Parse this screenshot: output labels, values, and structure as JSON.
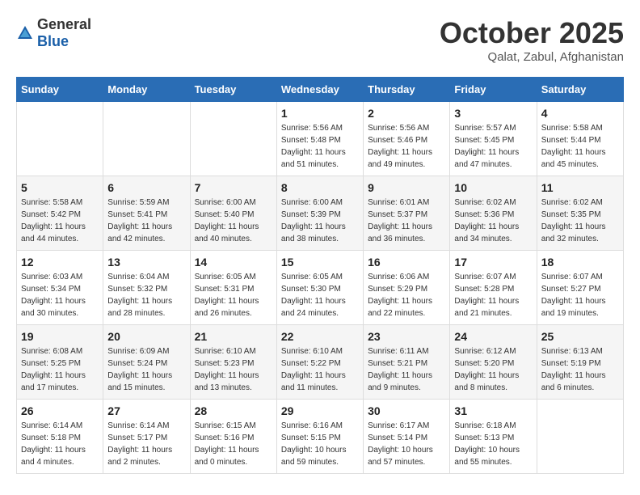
{
  "logo": {
    "general": "General",
    "blue": "Blue"
  },
  "header": {
    "title": "October 2025",
    "subtitle": "Qalat, Zabul, Afghanistan"
  },
  "weekdays": [
    "Sunday",
    "Monday",
    "Tuesday",
    "Wednesday",
    "Thursday",
    "Friday",
    "Saturday"
  ],
  "weeks": [
    [
      {
        "day": "",
        "info": ""
      },
      {
        "day": "",
        "info": ""
      },
      {
        "day": "",
        "info": ""
      },
      {
        "day": "1",
        "info": "Sunrise: 5:56 AM\nSunset: 5:48 PM\nDaylight: 11 hours\nand 51 minutes."
      },
      {
        "day": "2",
        "info": "Sunrise: 5:56 AM\nSunset: 5:46 PM\nDaylight: 11 hours\nand 49 minutes."
      },
      {
        "day": "3",
        "info": "Sunrise: 5:57 AM\nSunset: 5:45 PM\nDaylight: 11 hours\nand 47 minutes."
      },
      {
        "day": "4",
        "info": "Sunrise: 5:58 AM\nSunset: 5:44 PM\nDaylight: 11 hours\nand 45 minutes."
      }
    ],
    [
      {
        "day": "5",
        "info": "Sunrise: 5:58 AM\nSunset: 5:42 PM\nDaylight: 11 hours\nand 44 minutes."
      },
      {
        "day": "6",
        "info": "Sunrise: 5:59 AM\nSunset: 5:41 PM\nDaylight: 11 hours\nand 42 minutes."
      },
      {
        "day": "7",
        "info": "Sunrise: 6:00 AM\nSunset: 5:40 PM\nDaylight: 11 hours\nand 40 minutes."
      },
      {
        "day": "8",
        "info": "Sunrise: 6:00 AM\nSunset: 5:39 PM\nDaylight: 11 hours\nand 38 minutes."
      },
      {
        "day": "9",
        "info": "Sunrise: 6:01 AM\nSunset: 5:37 PM\nDaylight: 11 hours\nand 36 minutes."
      },
      {
        "day": "10",
        "info": "Sunrise: 6:02 AM\nSunset: 5:36 PM\nDaylight: 11 hours\nand 34 minutes."
      },
      {
        "day": "11",
        "info": "Sunrise: 6:02 AM\nSunset: 5:35 PM\nDaylight: 11 hours\nand 32 minutes."
      }
    ],
    [
      {
        "day": "12",
        "info": "Sunrise: 6:03 AM\nSunset: 5:34 PM\nDaylight: 11 hours\nand 30 minutes."
      },
      {
        "day": "13",
        "info": "Sunrise: 6:04 AM\nSunset: 5:32 PM\nDaylight: 11 hours\nand 28 minutes."
      },
      {
        "day": "14",
        "info": "Sunrise: 6:05 AM\nSunset: 5:31 PM\nDaylight: 11 hours\nand 26 minutes."
      },
      {
        "day": "15",
        "info": "Sunrise: 6:05 AM\nSunset: 5:30 PM\nDaylight: 11 hours\nand 24 minutes."
      },
      {
        "day": "16",
        "info": "Sunrise: 6:06 AM\nSunset: 5:29 PM\nDaylight: 11 hours\nand 22 minutes."
      },
      {
        "day": "17",
        "info": "Sunrise: 6:07 AM\nSunset: 5:28 PM\nDaylight: 11 hours\nand 21 minutes."
      },
      {
        "day": "18",
        "info": "Sunrise: 6:07 AM\nSunset: 5:27 PM\nDaylight: 11 hours\nand 19 minutes."
      }
    ],
    [
      {
        "day": "19",
        "info": "Sunrise: 6:08 AM\nSunset: 5:25 PM\nDaylight: 11 hours\nand 17 minutes."
      },
      {
        "day": "20",
        "info": "Sunrise: 6:09 AM\nSunset: 5:24 PM\nDaylight: 11 hours\nand 15 minutes."
      },
      {
        "day": "21",
        "info": "Sunrise: 6:10 AM\nSunset: 5:23 PM\nDaylight: 11 hours\nand 13 minutes."
      },
      {
        "day": "22",
        "info": "Sunrise: 6:10 AM\nSunset: 5:22 PM\nDaylight: 11 hours\nand 11 minutes."
      },
      {
        "day": "23",
        "info": "Sunrise: 6:11 AM\nSunset: 5:21 PM\nDaylight: 11 hours\nand 9 minutes."
      },
      {
        "day": "24",
        "info": "Sunrise: 6:12 AM\nSunset: 5:20 PM\nDaylight: 11 hours\nand 8 minutes."
      },
      {
        "day": "25",
        "info": "Sunrise: 6:13 AM\nSunset: 5:19 PM\nDaylight: 11 hours\nand 6 minutes."
      }
    ],
    [
      {
        "day": "26",
        "info": "Sunrise: 6:14 AM\nSunset: 5:18 PM\nDaylight: 11 hours\nand 4 minutes."
      },
      {
        "day": "27",
        "info": "Sunrise: 6:14 AM\nSunset: 5:17 PM\nDaylight: 11 hours\nand 2 minutes."
      },
      {
        "day": "28",
        "info": "Sunrise: 6:15 AM\nSunset: 5:16 PM\nDaylight: 11 hours\nand 0 minutes."
      },
      {
        "day": "29",
        "info": "Sunrise: 6:16 AM\nSunset: 5:15 PM\nDaylight: 10 hours\nand 59 minutes."
      },
      {
        "day": "30",
        "info": "Sunrise: 6:17 AM\nSunset: 5:14 PM\nDaylight: 10 hours\nand 57 minutes."
      },
      {
        "day": "31",
        "info": "Sunrise: 6:18 AM\nSunset: 5:13 PM\nDaylight: 10 hours\nand 55 minutes."
      },
      {
        "day": "",
        "info": ""
      }
    ]
  ]
}
